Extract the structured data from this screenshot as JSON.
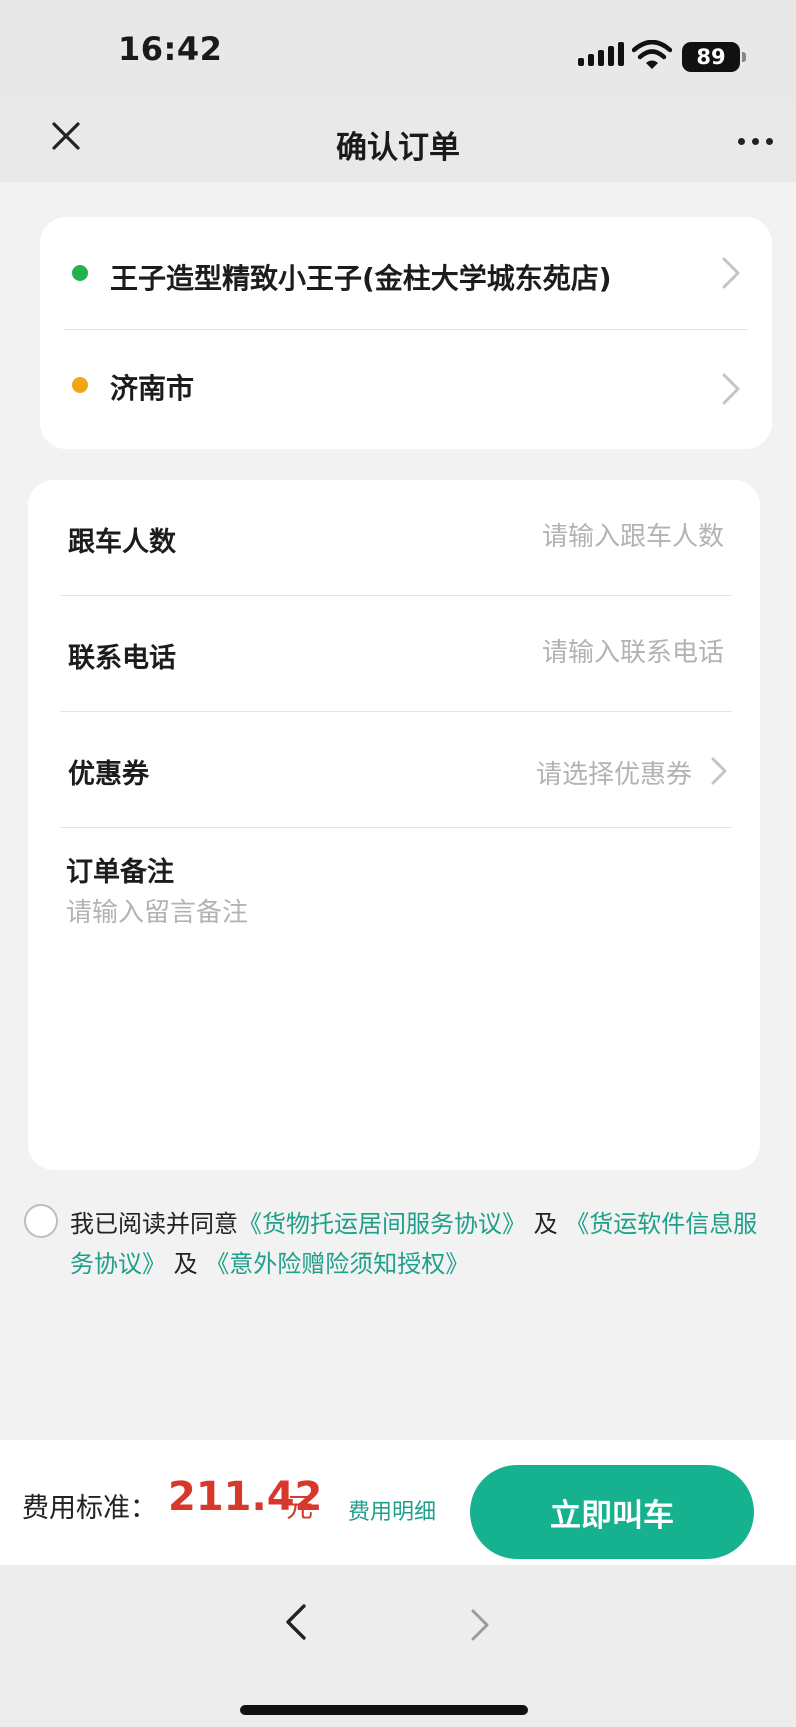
{
  "status_bar": {
    "time": "16:42",
    "battery_level": "89",
    "signal_icon": "signal-icon",
    "wifi_icon": "wifi-icon"
  },
  "nav": {
    "title": "确认订单",
    "close_icon": "close-icon",
    "more_icon": "more-icon"
  },
  "route": {
    "origin": "王子造型精致小王子(金柱大学城东苑店)",
    "destination": "济南市",
    "origin_dot_color": "#22b14c",
    "destination_dot_color": "#f2a516"
  },
  "form": {
    "passengers": {
      "label": "跟车人数",
      "placeholder": "请输入跟车人数",
      "value": ""
    },
    "phone": {
      "label": "联系电话",
      "placeholder": "请输入联系电话",
      "value": ""
    },
    "coupon": {
      "label": "优惠券",
      "value": "请选择优惠券"
    },
    "remark": {
      "label": "订单备注",
      "placeholder": "请输入留言备注",
      "value": ""
    }
  },
  "agreement": {
    "checked": false,
    "prefix": "我已阅读并同意",
    "link1": "《货物托运居间服务协议》",
    "and1": "及",
    "link2": "《货运软件信息服务协议》",
    "and2": "及",
    "link3": "《意外险赠险须知授权》"
  },
  "footer": {
    "fee_label": "费用标准：",
    "fee_amount": "211.42",
    "fee_unit": "元",
    "fee_detail": "费用明细",
    "call_button": "立即叫车"
  },
  "colors": {
    "accent": "#16b18f",
    "link": "#1fa08a",
    "price": "#d8372b"
  }
}
